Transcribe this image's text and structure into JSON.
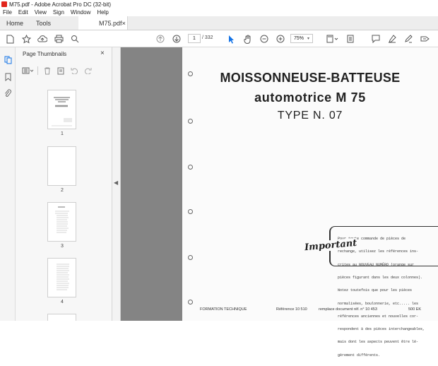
{
  "window": {
    "title": "M75.pdf - Adobe Acrobat Pro DC (32-bit)"
  },
  "menu": [
    "File",
    "Edit",
    "View",
    "Sign",
    "Window",
    "Help"
  ],
  "tabs": {
    "home": "Home",
    "tools": "Tools",
    "document": "M75.pdf",
    "close": "×"
  },
  "toolbar": {
    "current_page": "1",
    "page_count": "/ 332",
    "zoom": "75%"
  },
  "thumbnails_panel": {
    "title": "Page Thumbnails",
    "close": "×",
    "pages": [
      "1",
      "2",
      "3",
      "4"
    ]
  },
  "document_page": {
    "title_line1": "MOISSONNEUSE-BATTEUSE",
    "title_line2": "automotrice M 75",
    "title_line3": "TYPE N. 07",
    "important_word": "Important",
    "important_text": [
      "Pour toute commande de pièces de",
      "rechange, utilisez les références ins-",
      "crites au NOUVEAU NUMÉRO (orange sur",
      "pièces figurant dans les deux colonnes).",
      "Notez toutefois que pour les pièces",
      "normalisées, boulonnerie, etc..... les",
      "références anciennes et nouvelles cor-",
      "respondent à des pièces interchangeables,",
      "mais dont les aspects peuvent être lé-",
      "gèrement différents."
    ],
    "footer_left": "FORMATION TECHNIQUE",
    "footer_ref": "Référence 10 510",
    "footer_replace": "remplace document réf. n° 10 453",
    "footer_right": "500 EK"
  },
  "colors": {
    "accent": "#1473e6",
    "viewer_bg": "#848484",
    "pdf_icon": "#e1251b"
  }
}
